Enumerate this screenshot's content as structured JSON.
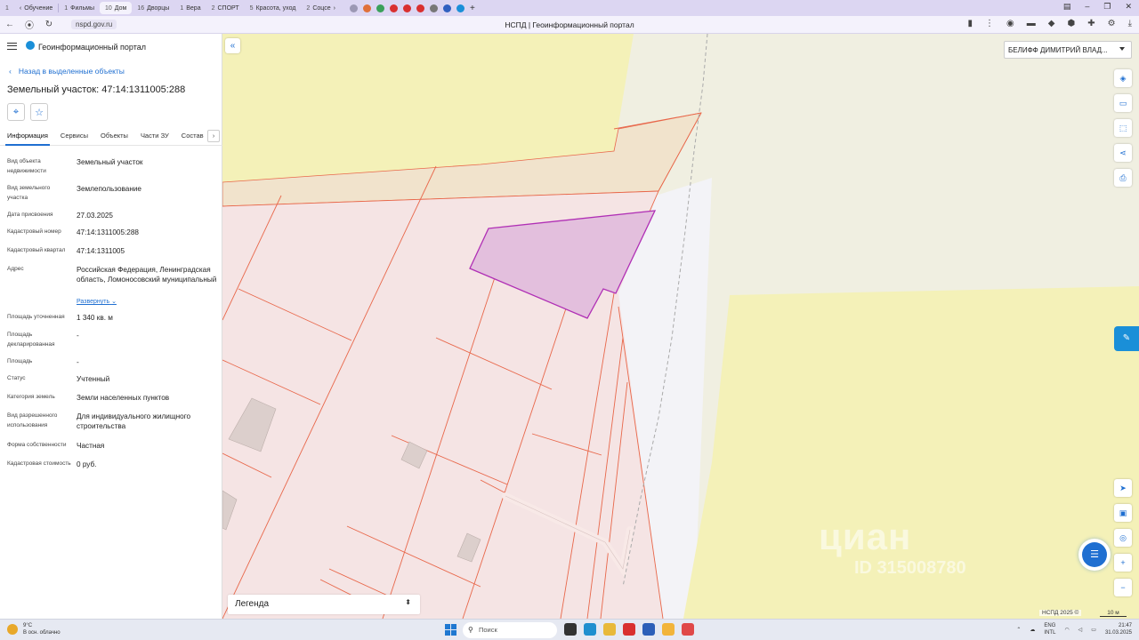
{
  "browser": {
    "tabs": [
      {
        "count": "1",
        "label": ""
      },
      {
        "count": "",
        "label": "Обучение"
      },
      {
        "count": "1",
        "label": "Фильмы"
      },
      {
        "count": "10",
        "label": "Дом"
      },
      {
        "count": "16",
        "label": "Дворцы"
      },
      {
        "count": "1",
        "label": "Вера"
      },
      {
        "count": "2",
        "label": "СПОРТ"
      },
      {
        "count": "5",
        "label": "Красота, уход"
      },
      {
        "count": "2",
        "label": "Соцсе"
      }
    ],
    "url": "nspd.gov.ru",
    "page_title": "НСПД | Геоинформационный портал"
  },
  "panel": {
    "portal_name": "Геоинформационный портал",
    "back_link": "Назад в выделенные объекты",
    "title": "Земельный участок: 47:14:1311005:288",
    "tabs": [
      "Информация",
      "Сервисы",
      "Объекты",
      "Части ЗУ",
      "Состав"
    ],
    "rows": [
      {
        "label": "Вид объекта недвижимости",
        "value": "Земельный участок"
      },
      {
        "label": "Вид земельного участка",
        "value": "Землепользование"
      },
      {
        "label": "Дата присвоения",
        "value": "27.03.2025"
      },
      {
        "label": "Кадастровый номер",
        "value": "47:14:1311005:288"
      },
      {
        "label": "Кадастровый квартал",
        "value": "47:14:1311005"
      },
      {
        "label": "Адрес",
        "value": "Российская Федерация, Ленинградская область, Ломоносовский муниципальный",
        "expand": "Развернуть"
      },
      {
        "label": "Площадь уточненная",
        "value": "1 340 кв. м"
      },
      {
        "label": "Площадь декларированная",
        "value": "-"
      },
      {
        "label": "Площадь",
        "value": "-"
      },
      {
        "label": "Статус",
        "value": "Учтенный"
      },
      {
        "label": "Категория земель",
        "value": "Земли населенных пунктов"
      },
      {
        "label": "Вид разрешенного использования",
        "value": "Для индивидуального жилищного строительства"
      },
      {
        "label": "Форма собственности",
        "value": "Частная"
      },
      {
        "label": "Кадастровая стоимость",
        "value": "0 руб."
      }
    ]
  },
  "map": {
    "user_name": "БЕЛИФФ ДИМИТРИЙ ВЛАД...",
    "legend_label": "Легенда",
    "copyright": "НСПД 2025 ©",
    "scale_label": "10 м",
    "watermark": "циан",
    "watermark_id": "ID 315008780",
    "colors": {
      "parcel_line": "#e8674a",
      "selected_fill": "#e3bfdd",
      "selected_stroke": "#b02fb5",
      "yellow_zone": "#f4f1b8"
    }
  },
  "taskbar": {
    "weather_temp": "9°C",
    "weather_desc": "В осн. облачно",
    "search_placeholder": "Поиск",
    "lang_top": "ENG",
    "lang_bottom": "INTL",
    "time": "21:47",
    "date": "31.03.2025"
  }
}
